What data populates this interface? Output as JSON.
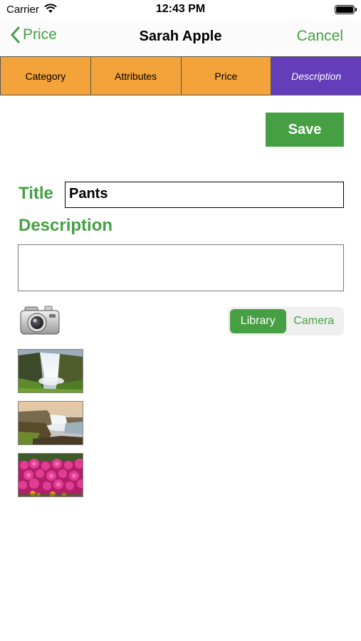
{
  "status_bar": {
    "carrier": "Carrier",
    "time": "12:43 PM"
  },
  "nav": {
    "back_label": "Price",
    "title": "Sarah Apple",
    "cancel_label": "Cancel"
  },
  "tabs": [
    {
      "label": "Category"
    },
    {
      "label": "Attributes"
    },
    {
      "label": "Price"
    },
    {
      "label": "Description",
      "active": true
    }
  ],
  "form": {
    "save_label": "Save",
    "title_label": "Title",
    "title_value": "Pants",
    "description_label": "Description",
    "description_value": ""
  },
  "photo_source": {
    "options": [
      "Library",
      "Camera"
    ],
    "selected": "Library"
  },
  "photos": [
    {
      "icon": "waterfall-photo"
    },
    {
      "icon": "coastal-waterfall-photo"
    },
    {
      "icon": "pink-flowers-photo"
    }
  ],
  "colors": {
    "accent_green": "#46a043",
    "tab_orange": "#f3a33a",
    "tab_active_purple": "#643dba"
  }
}
